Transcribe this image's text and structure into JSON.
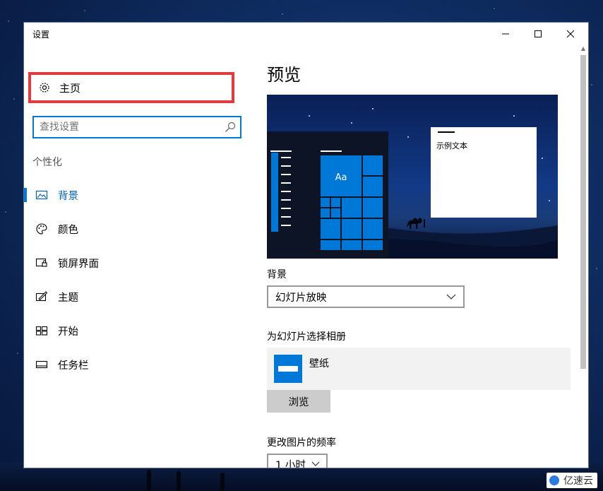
{
  "window": {
    "title": "设置"
  },
  "titlebar": {
    "minimize_icon": "minimize-icon",
    "maximize_icon": "maximize-icon",
    "close_icon": "close-icon"
  },
  "sidebar": {
    "home_label": "主页",
    "search_placeholder": "查找设置",
    "section_label": "个性化",
    "items": [
      {
        "label": "背景",
        "icon": "image-icon",
        "active": true
      },
      {
        "label": "颜色",
        "icon": "palette-icon"
      },
      {
        "label": "锁屏界面",
        "icon": "lock-screen-icon"
      },
      {
        "label": "主题",
        "icon": "theme-icon"
      },
      {
        "label": "开始",
        "icon": "start-icon"
      },
      {
        "label": "任务栏",
        "icon": "taskbar-icon"
      }
    ]
  },
  "main": {
    "heading": "预览",
    "preview": {
      "tile_label": "Aa",
      "sample_text": "示例文本"
    },
    "background_label": "背景",
    "background_value": "幻灯片放映",
    "album_label": "为幻灯片选择相册",
    "album_name": "壁纸",
    "browse_label": "浏览",
    "interval_label": "更改图片的频率",
    "interval_value": "1 小时"
  },
  "watermark": {
    "text": "亿速云"
  },
  "colors": {
    "accent": "#0078d7",
    "highlight_border": "#e53a3a"
  }
}
